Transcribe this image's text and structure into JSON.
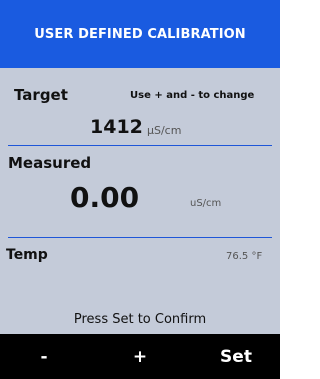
{
  "header": {
    "title": "USER DEFINED CALIBRATION"
  },
  "target": {
    "label": "Target",
    "hint": "Use + and - to change",
    "value": "1412",
    "unit": "µS/cm"
  },
  "measured": {
    "label": "Measured",
    "value": "0.00",
    "unit": "uS/cm"
  },
  "temp": {
    "label": "Temp",
    "value": "76.5 °F"
  },
  "confirm_text": "Press Set to Confirm",
  "buttons": {
    "minus": "-",
    "plus": "+",
    "set": "Set"
  },
  "colors": {
    "header_bg": "#1a5be0",
    "panel_bg": "#c4cbd9",
    "divider": "#1e56d8",
    "button_bar_bg": "#000000"
  }
}
